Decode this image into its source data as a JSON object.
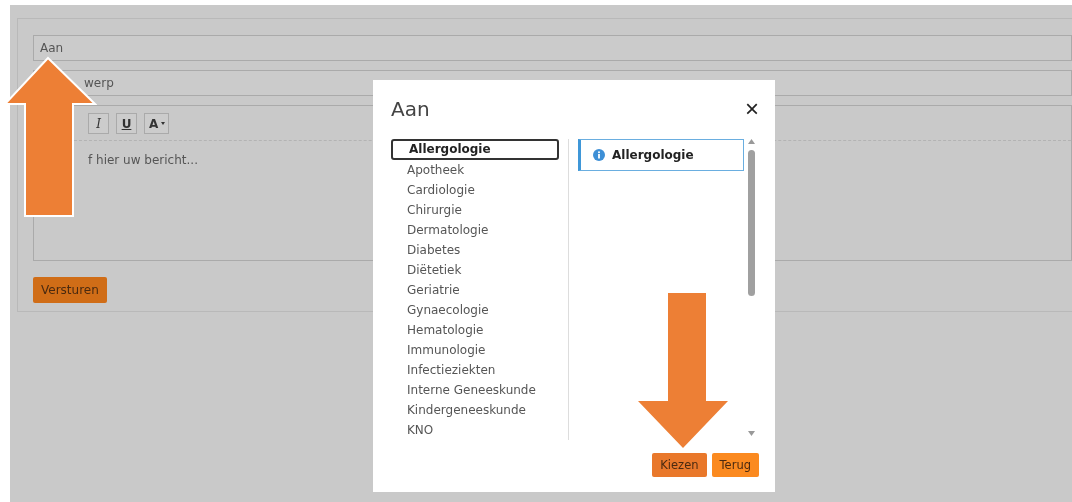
{
  "form": {
    "to_field": {
      "placeholder": "Aan"
    },
    "subject_field": {
      "placeholder": "werp"
    },
    "toolbar": [
      {
        "kind": "italic",
        "label": "I"
      },
      {
        "kind": "underline",
        "label": "U"
      },
      {
        "kind": "color",
        "label": "A"
      }
    ],
    "message_field": {
      "placeholder": "f hier uw bericht..."
    },
    "send_button": "Versturen"
  },
  "dialog": {
    "title": "Aan",
    "close": "×",
    "departments": [
      {
        "label": "Allergologie",
        "selected": true
      },
      {
        "label": "Apotheek",
        "selected": false
      },
      {
        "label": "Cardiologie",
        "selected": false
      },
      {
        "label": "Chirurgie",
        "selected": false
      },
      {
        "label": "Dermatologie",
        "selected": false
      },
      {
        "label": "Diabetes",
        "selected": false
      },
      {
        "label": "Diëtetiek",
        "selected": false
      },
      {
        "label": "Geriatrie",
        "selected": false
      },
      {
        "label": "Gynaecologie",
        "selected": false
      },
      {
        "label": "Hematologie",
        "selected": false
      },
      {
        "label": "Immunologie",
        "selected": false
      },
      {
        "label": "Infectieziekten",
        "selected": false
      },
      {
        "label": "Interne Geneeskunde",
        "selected": false
      },
      {
        "label": "Kindergeneeskunde",
        "selected": false
      },
      {
        "label": "KNO",
        "selected": false
      }
    ],
    "chosen": [
      {
        "label": "Allergologie"
      }
    ],
    "buttons": [
      {
        "label": "Kiezen",
        "kind": "primary"
      },
      {
        "label": "Terug",
        "kind": "secondary"
      }
    ]
  }
}
